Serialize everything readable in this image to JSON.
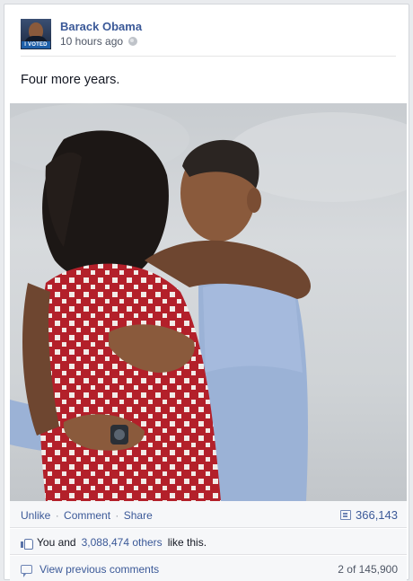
{
  "post": {
    "author": "Barack Obama",
    "timestamp": "10 hours ago",
    "text": "Four more years.",
    "avatar_badge": "I VOTED"
  },
  "actions": {
    "unlike": "Unlike",
    "comment": "Comment",
    "share": "Share",
    "separator": "·",
    "share_count": "366,143"
  },
  "likes": {
    "prefix": "You and",
    "others": "3,088,474 others",
    "suffix": "like this."
  },
  "comments": {
    "view_previous": "View previous comments",
    "count": "2 of 145,900"
  },
  "icons": {
    "privacy": "globe-icon",
    "shares": "share-icon",
    "like": "thumb-icon",
    "comments": "comment-icon"
  },
  "colors": {
    "link": "#3b5998",
    "dress_red": "#b3202a",
    "shirt_blue": "#9bb2d6"
  }
}
